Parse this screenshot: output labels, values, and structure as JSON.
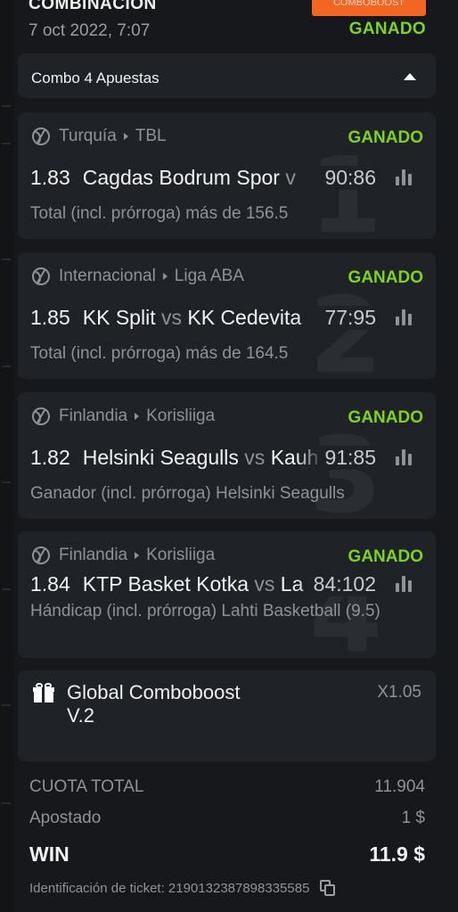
{
  "header": {
    "bet_type": "COMBINACION",
    "badge": "COMBOBOOST",
    "date": "7 oct 2022, 7:07",
    "status": "GANADO"
  },
  "combo": {
    "title": "Combo 4 Apuestas",
    "toggle_icon": "caret-up-icon"
  },
  "bets": [
    {
      "number": "1",
      "country": "Turquía",
      "league": "TBL",
      "status": "GANADO",
      "odds": "1.83",
      "home": "Cagdas Bodrum Spor",
      "vs": "v",
      "away": "",
      "score": "90:86",
      "market": "Total (incl. prórroga) más de 156.5"
    },
    {
      "number": "2",
      "country": "Internacional",
      "league": "Liga ABA",
      "status": "GANADO",
      "odds": "1.85",
      "home": "KK Split",
      "vs": "vs",
      "away": "KK Cedevita",
      "score": "77:95",
      "market": "Total (incl. prórroga) más de 164.5"
    },
    {
      "number": "3",
      "country": "Finlandia",
      "league": "Korisliiga",
      "status": "GANADO",
      "odds": "1.82",
      "home": "Helsinki Seagulls",
      "vs": "vs",
      "away": "Kauh",
      "score": "91:85",
      "market": "Ganador (incl. prórroga) Helsinki Seagulls"
    },
    {
      "number": "4",
      "country": "Finlandia",
      "league": "Korisliiga",
      "status": "GANADO",
      "odds": "1.84",
      "home": "KTP Basket Kotka",
      "vs": "vs",
      "away": "La",
      "score": "84:102",
      "market": "Hándicap (incl. prórroga) Lahti Basketball (9.5)"
    }
  ],
  "boost": {
    "name": "Global Comboboost V.2",
    "multiplier": "X1.05",
    "icon": "gift-icon"
  },
  "summary": {
    "total_odds_label": "CUOTA TOTAL",
    "total_odds_value": "11.904",
    "stake_label": "Apostado",
    "stake_value": "1 $",
    "win_label": "WIN",
    "win_value": "11.9 $"
  },
  "ticket": {
    "id_text": "Identificación de ticket: 2190132387898335585",
    "copy_icon": "copy-icon"
  },
  "colors": {
    "background": "#16181b",
    "card": "#1f2226",
    "win_green": "#7ed321",
    "badge_orange": "#f26522",
    "muted_text": "#8f9297"
  }
}
